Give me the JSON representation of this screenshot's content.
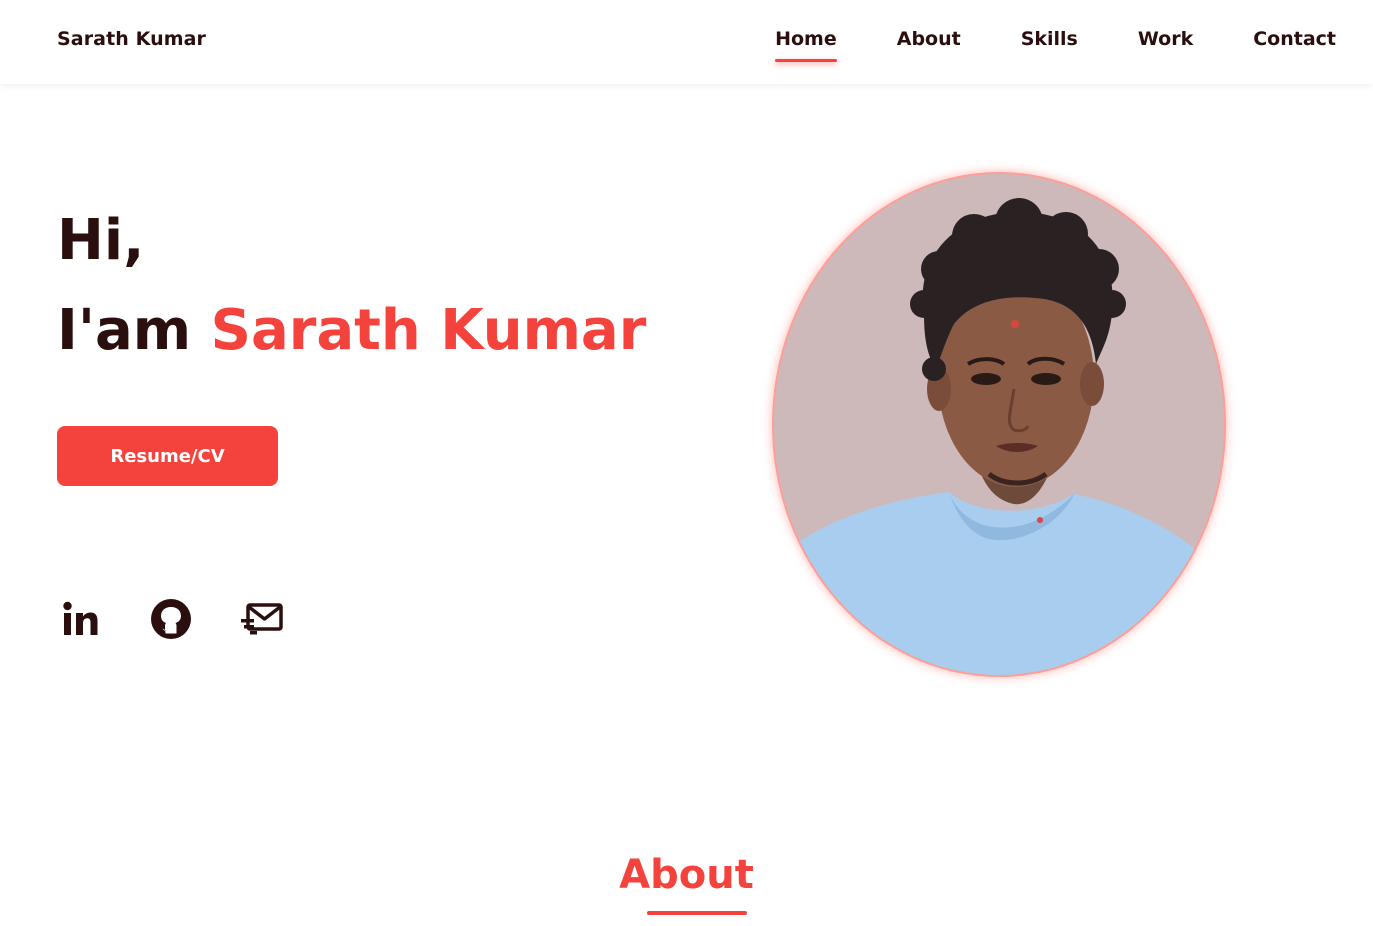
{
  "header": {
    "logo": "Sarath Kumar",
    "nav": [
      {
        "label": "Home",
        "active": true
      },
      {
        "label": "About",
        "active": false
      },
      {
        "label": "Skills",
        "active": false
      },
      {
        "label": "Work",
        "active": false
      },
      {
        "label": "Contact",
        "active": false
      }
    ]
  },
  "hero": {
    "greeting": "Hi,",
    "intro_prefix": "I'am",
    "name": "Sarath Kumar",
    "resume_button": "Resume/CV",
    "socials": [
      {
        "icon": "linkedin-icon"
      },
      {
        "icon": "github-icon"
      },
      {
        "icon": "mail-icon"
      }
    ],
    "portrait": {
      "icon": "profile-photo"
    }
  },
  "about": {
    "title": "About"
  },
  "colors": {
    "accent": "#f4433c",
    "text_dark": "#2b0f0f",
    "portrait_bg": "#cdb9ba"
  }
}
